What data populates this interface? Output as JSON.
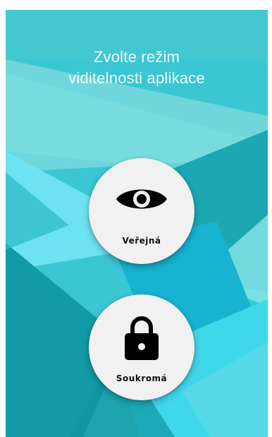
{
  "title": {
    "line1": "Zvolte režim",
    "line2": "viditelnosti aplikace"
  },
  "options": [
    {
      "label": "Veřejná",
      "icon": "eye-icon"
    },
    {
      "label": "Soukromá",
      "icon": "lock-icon"
    }
  ],
  "colors": {
    "background": "#3bc6d3",
    "button": "#f1f1f1",
    "icon": "#000000"
  }
}
